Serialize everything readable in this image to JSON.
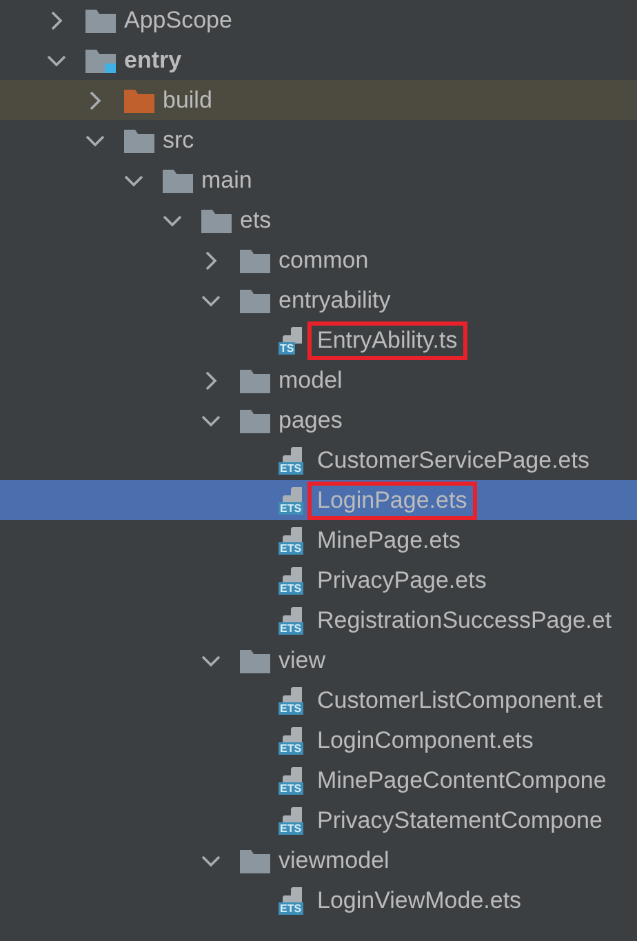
{
  "tree": [
    {
      "kind": "folder",
      "name": "AppScope",
      "expanded": false
    },
    {
      "kind": "module",
      "name": "entry",
      "expanded": true,
      "children": [
        {
          "kind": "excluded-folder",
          "name": "build",
          "expanded": false,
          "highlighted": true
        },
        {
          "kind": "folder",
          "name": "src",
          "expanded": true,
          "children": [
            {
              "kind": "folder",
              "name": "main",
              "expanded": true,
              "children": [
                {
                  "kind": "folder",
                  "name": "ets",
                  "expanded": true,
                  "children": [
                    {
                      "kind": "folder",
                      "name": "common",
                      "expanded": false
                    },
                    {
                      "kind": "folder",
                      "name": "entryability",
                      "expanded": true,
                      "children": [
                        {
                          "kind": "file",
                          "name": "EntryAbility.ts",
                          "badge": "TS",
                          "marked": true,
                          "selected": false
                        }
                      ]
                    },
                    {
                      "kind": "folder",
                      "name": "model",
                      "expanded": false
                    },
                    {
                      "kind": "folder",
                      "name": "pages",
                      "expanded": true,
                      "children": [
                        {
                          "kind": "file",
                          "name": "CustomerServicePage.ets",
                          "badge": "ETS",
                          "marked": false,
                          "selected": false
                        },
                        {
                          "kind": "file",
                          "name": "LoginPage.ets",
                          "badge": "ETS",
                          "marked": true,
                          "selected": true
                        },
                        {
                          "kind": "file",
                          "name": "MinePage.ets",
                          "badge": "ETS",
                          "marked": false,
                          "selected": false
                        },
                        {
                          "kind": "file",
                          "name": "PrivacyPage.ets",
                          "badge": "ETS",
                          "marked": false,
                          "selected": false
                        },
                        {
                          "kind": "file",
                          "name": "RegistrationSuccessPage.et",
                          "badge": "ETS",
                          "marked": false,
                          "selected": false
                        }
                      ]
                    },
                    {
                      "kind": "folder",
                      "name": "view",
                      "expanded": true,
                      "children": [
                        {
                          "kind": "file",
                          "name": "CustomerListComponent.et",
                          "badge": "ETS",
                          "marked": false,
                          "selected": false
                        },
                        {
                          "kind": "file",
                          "name": "LoginComponent.ets",
                          "badge": "ETS",
                          "marked": false,
                          "selected": false
                        },
                        {
                          "kind": "file",
                          "name": "MinePageContentCompone",
                          "badge": "ETS",
                          "marked": false,
                          "selected": false
                        },
                        {
                          "kind": "file",
                          "name": "PrivacyStatementCompone",
                          "badge": "ETS",
                          "marked": false,
                          "selected": false
                        }
                      ]
                    },
                    {
                      "kind": "folder",
                      "name": "viewmodel",
                      "expanded": true,
                      "children": [
                        {
                          "kind": "file",
                          "name": "LoginViewMode.ets",
                          "badge": "ETS",
                          "marked": false,
                          "selected": false
                        }
                      ]
                    }
                  ]
                }
              ]
            }
          ]
        }
      ]
    }
  ]
}
